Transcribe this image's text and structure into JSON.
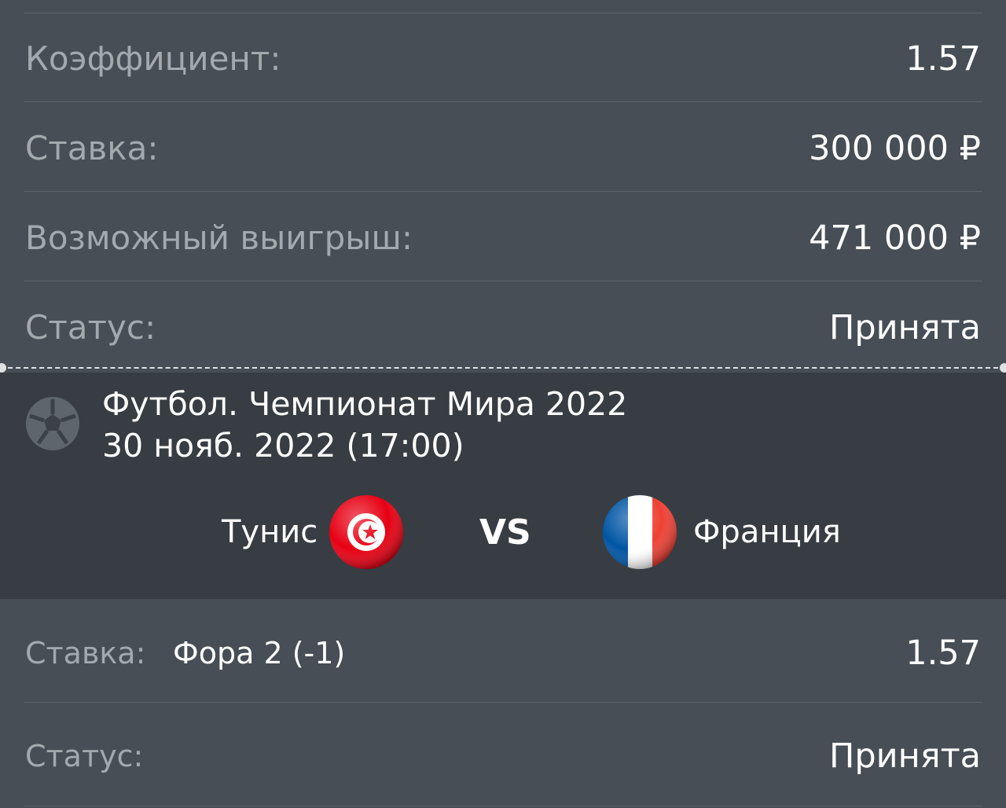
{
  "summary": {
    "odds": {
      "label": "Коэффициент:",
      "value": "1.57"
    },
    "stake": {
      "label": "Ставка:",
      "value": "300 000 ₽"
    },
    "potential_win": {
      "label": "Возможный выигрыш:",
      "value": "471 000 ₽"
    },
    "status": {
      "label": "Статус:",
      "value": "Принята"
    }
  },
  "event": {
    "sport_icon": "football-icon",
    "title": "Футбол. Чемпионат Мира 2022",
    "datetime": "30 нояб. 2022 (17:00)",
    "home_team": {
      "name": "Тунис",
      "flag": "tunisia-flag-icon"
    },
    "vs_label": "VS",
    "away_team": {
      "name": "Франция",
      "flag": "france-flag-icon"
    }
  },
  "selection": {
    "bet_label": "Ставка:",
    "bet_value": "Фора 2 (-1)",
    "odds": "1.57",
    "status_label": "Статус:",
    "status_value": "Принята"
  },
  "colors": {
    "card_background": "#474e55",
    "match_background": "#373d42",
    "label_text": "#a3a9ae",
    "value_text": "#ffffff",
    "divider": "#5d646b",
    "tunisia_red": "#e70013",
    "france_blue": "#0055a4",
    "france_red": "#ef4135"
  }
}
